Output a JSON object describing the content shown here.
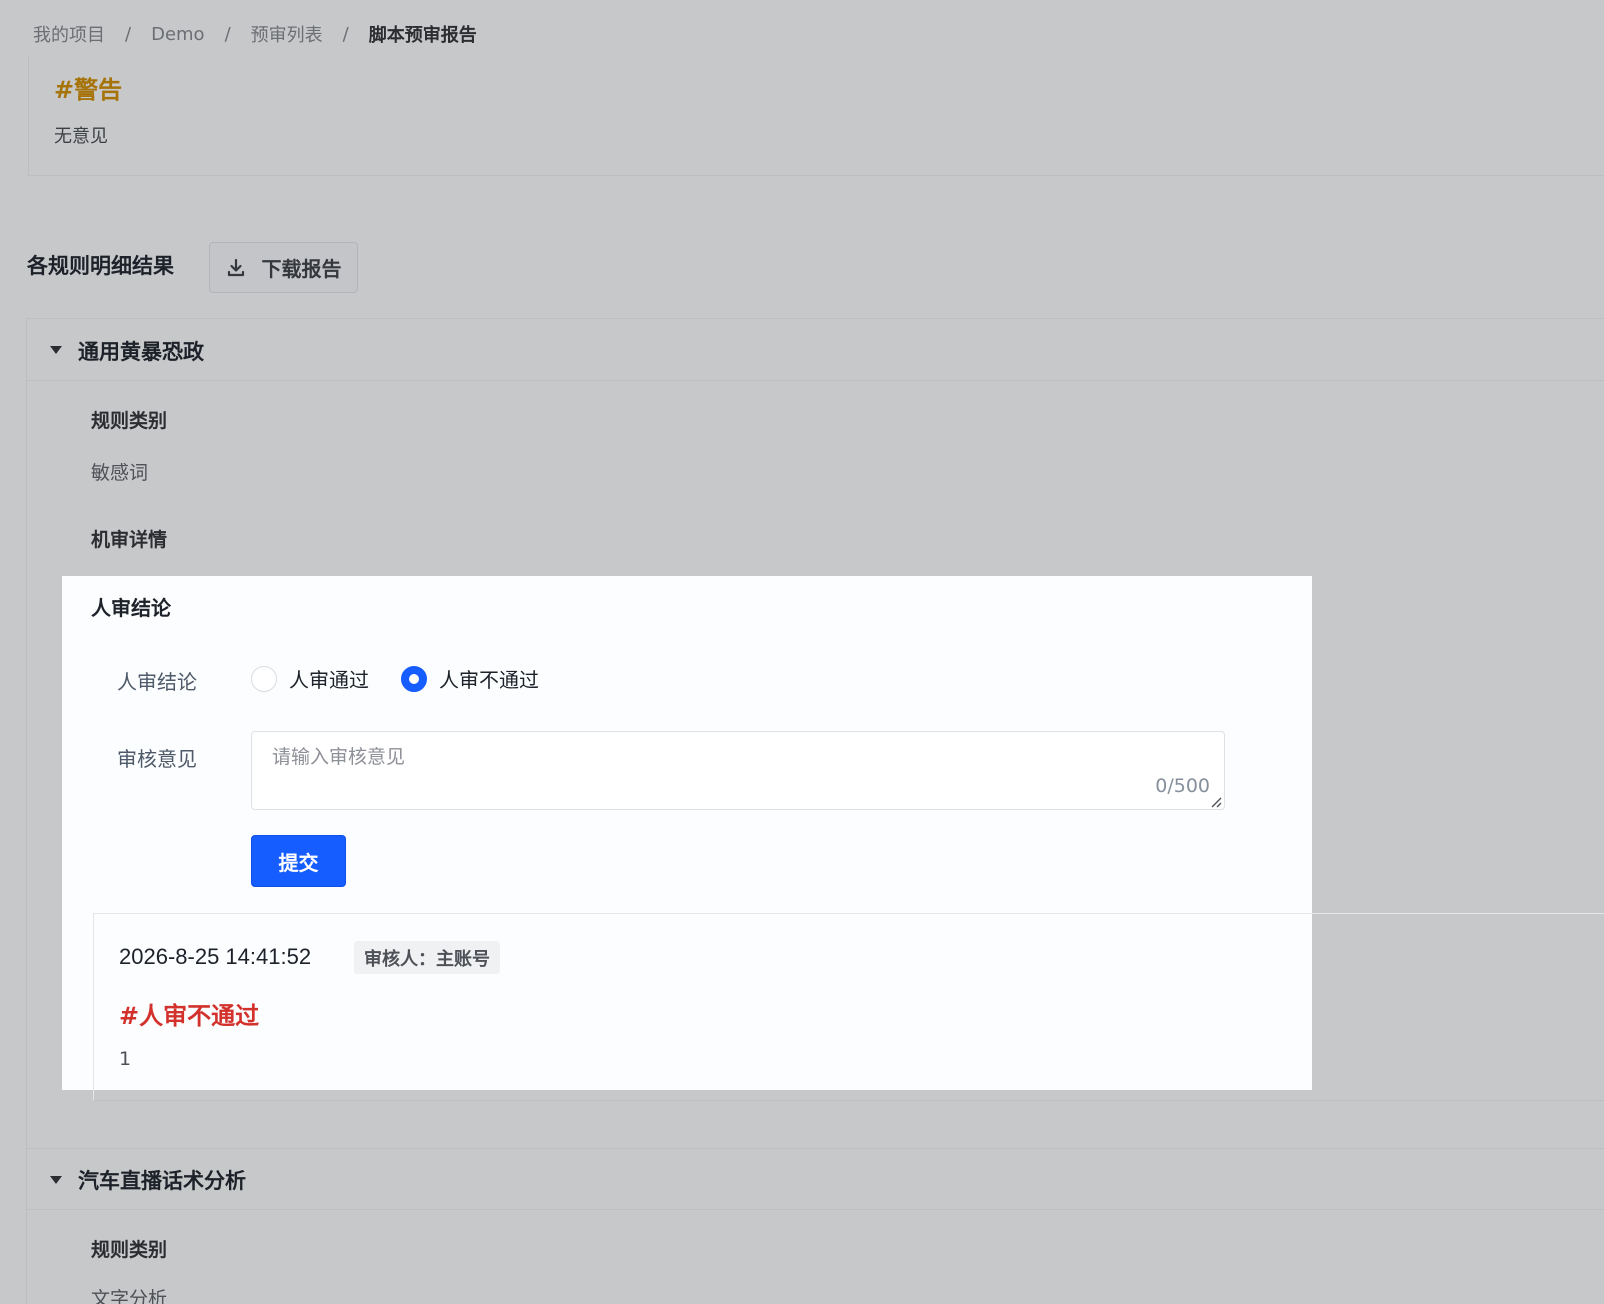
{
  "breadcrumb": {
    "items": [
      "我的项目",
      "Demo",
      "预审列表"
    ],
    "current": "脚本预审报告",
    "separator": "/"
  },
  "warning": {
    "title": "#警告",
    "body": "无意见",
    "color": "#a67308"
  },
  "rules_section": {
    "title": "各规则明细结果",
    "download_label": "下载报告"
  },
  "panels": [
    {
      "title": "通用黄暴恐政",
      "rule_type_label": "规则类别",
      "rule_type_value": "敏感词",
      "machine_detail_label": "机审详情",
      "human_review": {
        "section_title": "人审结论",
        "conclusion_label": "人审结论",
        "options": [
          "人审通过",
          "人审不通过"
        ],
        "selected": "人审不通过",
        "opinion_label": "审核意见",
        "opinion_placeholder": "请输入审核意见",
        "opinion_value": "",
        "counter": "0/500",
        "submit_label": "提交"
      },
      "record": {
        "time": "2026-8-25 14:41:52",
        "reviewer": "审核人：主账号",
        "verdict": "#人审不通过",
        "note": "1"
      }
    },
    {
      "title": "汽车直播话术分析",
      "rule_type_label": "规则类别",
      "rule_type_value": "文字分析"
    }
  ],
  "colors": {
    "primary": "#165dff",
    "danger": "#d2312c",
    "warning": "#a67308"
  }
}
